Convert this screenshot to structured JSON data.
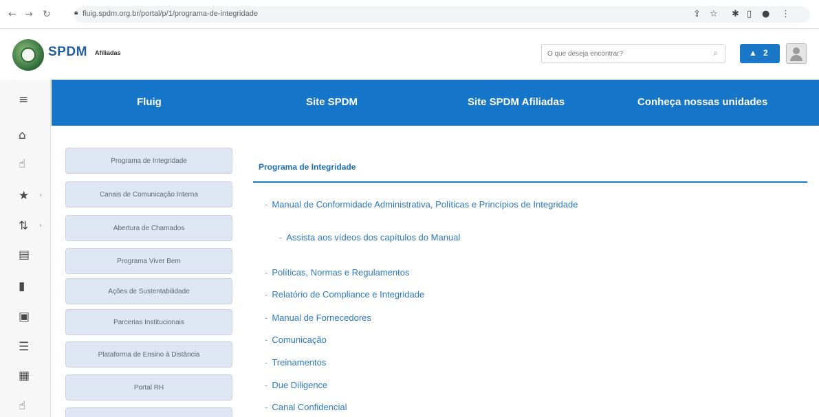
{
  "browser": {
    "url": "fluig.spdm.org.br/portal/p/1/programa-de-integridade",
    "icons": [
      "share-icon",
      "star-icon",
      "extensions-icon",
      "sidepanel-icon",
      "profile-icon",
      "menu-icon"
    ]
  },
  "header": {
    "brand": "SPDM",
    "brand_sub": "Afiliadas",
    "search_placeholder": "O que deseja encontrar?",
    "alert_count": "2"
  },
  "topnav": {
    "items": [
      {
        "label": "Fluig"
      },
      {
        "label": "Site SPDM"
      },
      {
        "label": "Site SPDM Afiliadas"
      },
      {
        "label": "Conheça nossas unidades"
      }
    ]
  },
  "sidebar": {
    "items": [
      {
        "label": "Programa de Integridade"
      },
      {
        "label": "Canais de Comunicação Interna"
      },
      {
        "label": "Abertura de Chamados"
      },
      {
        "label": "Programa Viver Bem"
      },
      {
        "label": "Ações de Sustentabilidade"
      },
      {
        "label": "Parcerias Institucionais"
      },
      {
        "label": "Plataforma de Ensino à Distância"
      },
      {
        "label": "Portal RH"
      }
    ]
  },
  "content": {
    "title": "Programa de Integridade",
    "links": [
      {
        "label": "Manual de Conformidade Administrativa, Políticas e Princípios de Integridade"
      },
      {
        "label": "Assista aos vídeos dos capítulos do Manual"
      },
      {
        "label": "Políticas, Normas e Regulamentos"
      },
      {
        "label": "Relatório de Compliance e Integridade"
      },
      {
        "label": "Manual de Fornecedores"
      },
      {
        "label": "Comunicação"
      },
      {
        "label": "Treinamentos"
      },
      {
        "label": "Due Diligence"
      },
      {
        "label": "Canal Confidencial"
      }
    ]
  },
  "colors": {
    "accent": "#1676c9",
    "menu_bg": "#dfe6f3",
    "link": "#2c79c4"
  }
}
